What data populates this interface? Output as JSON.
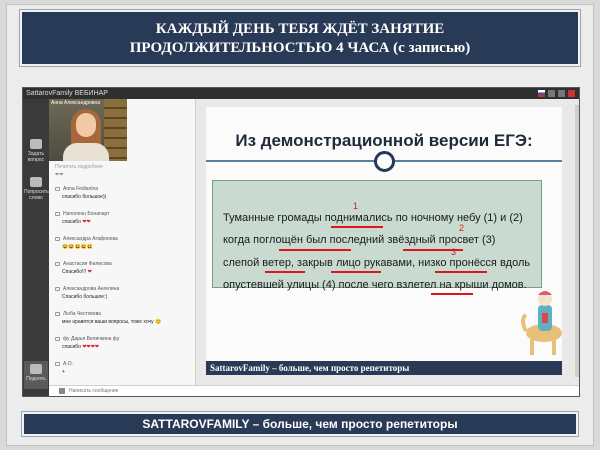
{
  "top_banner": {
    "line1": "КАЖДЫЙ ДЕНЬ ТЕБЯ ЖДЁТ ЗАНЯТИЕ",
    "line2": "ПРОДОЛЖИТЕЛЬНОСТЬЮ 4 ЧАСА (с записью)"
  },
  "app": {
    "title": "SattarovFamily ВЕБИНАР",
    "presenter_name": "Анна Александровна",
    "tools": {
      "ask_question": "Задать вопрос",
      "request_speak": "Попросить слово",
      "raise": "Поднять"
    },
    "chat": [
      {
        "who": "",
        "text": "",
        "partial": "Почитать подробнее",
        "emoji": "heart2"
      },
      {
        "who": "Anna Fedianina",
        "text": "спасибо большое))",
        "emoji": ""
      },
      {
        "who": "Наполеон Бонапарт",
        "text": "спасибо",
        "emoji": "heart2"
      },
      {
        "who": "Александра Агафонова",
        "text": "",
        "emoji": "laugh5"
      },
      {
        "who": "Анастасия Филисова",
        "text": "Спасибо!!!",
        "emoji": "heart1"
      },
      {
        "who": "Александрова Ангелина",
        "text": "Спасибо большое:)",
        "emoji": ""
      },
      {
        "who": "Люба Честякова",
        "text": "мне нравятся ваши вопросы, тоже хочу",
        "emoji": "laugh1"
      },
      {
        "who": "фу Дарья Величкина фу",
        "text": "спасибо",
        "emoji": "heart4"
      },
      {
        "who": "А.О.",
        "text": "+",
        "emoji": ""
      }
    ],
    "input_placeholder": "Написать сообщение"
  },
  "slide": {
    "title": "Из демонстрационной версии ЕГЭ:",
    "lines": [
      "Туманные громады поднимались по ночному небу (1) и (2)",
      "когда поглощён был последний звёздный просвет (3)",
      "слепой ветер, закрыв лицо рукавами, низко пронёсся вдоль",
      "опустевшей улицы (4) после чего взлетел на крыши домов."
    ],
    "annotations": [
      "1",
      "2",
      "3"
    ],
    "bottom_strip": "SattarovFamily – больше, чем просто репетиторы"
  },
  "bottom_banner": "SATTAROVFAMILY – больше, чем просто репетиторы",
  "emoji_glyphs": {
    "heart1": "❤",
    "heart2": "❤❤",
    "heart4": "❤❤❤❤",
    "laugh1": "😊",
    "laugh5": "😆😆😆😆😆"
  },
  "colors": {
    "navy": "#283a55",
    "slide_box": "#c9dbd0",
    "annotation_red": "#e0141c"
  }
}
